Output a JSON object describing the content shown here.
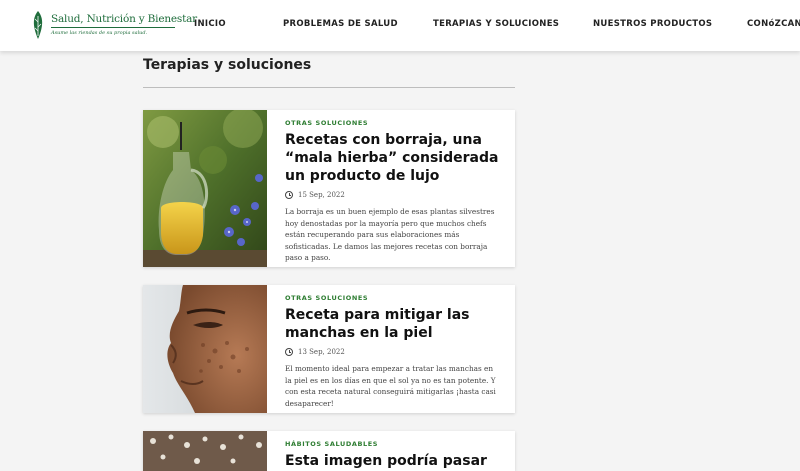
{
  "brand": {
    "name": "Salud, Nutrición y Bienestar",
    "tagline": "Asume las riendas de su propia salud.",
    "color": "#1f6d3c"
  },
  "nav": {
    "items": [
      {
        "label": "INICIO"
      },
      {
        "label": "PROBLEMAS DE SALUD"
      },
      {
        "label": "TERAPIAS Y SOLUCIONES"
      },
      {
        "label": "NUESTROS PRODUCTOS"
      },
      {
        "label": "CONóZCANO"
      }
    ]
  },
  "page": {
    "title": "Terapias y soluciones"
  },
  "accent_color": "#2e7d32",
  "icons": {
    "date": "clock-icon"
  },
  "articles": [
    {
      "category": "OTRAS SOLUCIONES",
      "title": "Recetas con borraja, una “mala hierba” considerada un producto de lujo",
      "date": "15 Sep, 2022",
      "excerpt": "La borraja es un buen ejemplo de esas plantas silvestres hoy denostadas por la mayoría pero que muchos chefs están recuperando para sus elaboraciones más sofisticadas. Le damos las mejores recetas con borraja paso a paso."
    },
    {
      "category": "OTRAS SOLUCIONES",
      "title": "Receta para mitigar las manchas en la piel",
      "date": "13 Sep, 2022",
      "excerpt": "El momento ideal para empezar a tratar las manchas en la piel es en los días en que el sol ya no es tan potente. Y con esta receta natural conseguirá mitigarlas ¡hasta casi desaparecer!"
    },
    {
      "category": "HÁBITOS SALUDABLES",
      "title": "Esta imagen podría pasar a la"
    }
  ]
}
